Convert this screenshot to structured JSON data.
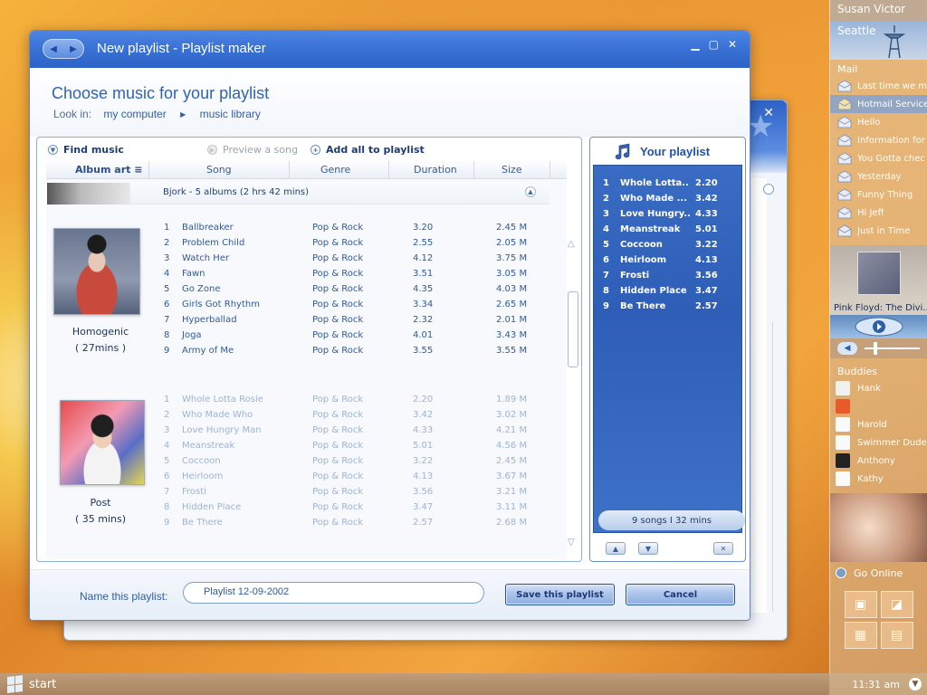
{
  "dialog": {
    "title": "New playlist - Playlist maker",
    "heading": "Choose music for your playlist",
    "look_in_label": "Look in:",
    "breadcrumb": [
      "my computer",
      "music library"
    ]
  },
  "toolbar": {
    "find_music": "Find music",
    "preview": "Preview a song",
    "add_all": "Add all to playlist"
  },
  "columns": [
    "Album art",
    "Song",
    "Genre",
    "Duration",
    "Size"
  ],
  "group": {
    "summary": "Bjork - 5 albums  (2 hrs 42 mins)"
  },
  "albums": [
    {
      "name": "Homogenic",
      "length": "( 27mins )",
      "tracks": [
        {
          "n": "1",
          "title": "Ballbreaker",
          "genre": "Pop & Rock",
          "duration": "3.20",
          "size": "2.45 M"
        },
        {
          "n": "2",
          "title": "Problem Child",
          "genre": "Pop & Rock",
          "duration": "2.55",
          "size": "2.05 M"
        },
        {
          "n": "3",
          "title": "Watch Her",
          "genre": "Pop & Rock",
          "duration": "4.12",
          "size": "3.75 M"
        },
        {
          "n": "4",
          "title": "Fawn",
          "genre": "Pop & Rock",
          "duration": "3.51",
          "size": "3.05 M"
        },
        {
          "n": "5",
          "title": "Go Zone",
          "genre": "Pop & Rock",
          "duration": "4.35",
          "size": "4.03 M"
        },
        {
          "n": "6",
          "title": "Girls Got Rhythm",
          "genre": "Pop & Rock",
          "duration": "3.34",
          "size": "2.65 M"
        },
        {
          "n": "7",
          "title": "Hyperballad",
          "genre": "Pop & Rock",
          "duration": "2.32",
          "size": "2.01 M"
        },
        {
          "n": "8",
          "title": "Joga",
          "genre": "Pop & Rock",
          "duration": "4.01",
          "size": "3.43 M"
        },
        {
          "n": "9",
          "title": "Army of Me",
          "genre": "Pop & Rock",
          "duration": "3.55",
          "size": "3.55 M"
        }
      ]
    },
    {
      "name": "Post",
      "length": "( 35 mins)",
      "tracks": [
        {
          "n": "1",
          "title": "Whole Lotta Rosie",
          "genre": "Pop & Rock",
          "duration": "2.20",
          "size": "1.89 M"
        },
        {
          "n": "2",
          "title": "Who Made Who",
          "genre": "Pop & Rock",
          "duration": "3.42",
          "size": "3.02 M"
        },
        {
          "n": "3",
          "title": "Love Hungry Man",
          "genre": "Pop & Rock",
          "duration": "4.33",
          "size": "4.21 M"
        },
        {
          "n": "4",
          "title": "Meanstreak",
          "genre": "Pop & Rock",
          "duration": "5.01",
          "size": "4.56 M"
        },
        {
          "n": "5",
          "title": "Coccoon",
          "genre": "Pop & Rock",
          "duration": "3.22",
          "size": "2.45 M"
        },
        {
          "n": "6",
          "title": "Heirloom",
          "genre": "Pop & Rock",
          "duration": "4.13",
          "size": "3.67 M"
        },
        {
          "n": "7",
          "title": "Frosti",
          "genre": "Pop & Rock",
          "duration": "3.56",
          "size": "3.21 M"
        },
        {
          "n": "8",
          "title": "Hidden Place",
          "genre": "Pop & Rock",
          "duration": "3.47",
          "size": "3.11 M"
        },
        {
          "n": "9",
          "title": "Be There",
          "genre": "Pop & Rock",
          "duration": "2.57",
          "size": "2.68 M"
        }
      ]
    }
  ],
  "playlist": {
    "title": "Your playlist",
    "items": [
      {
        "n": "1",
        "title": "Whole Lotta..",
        "duration": "2.20"
      },
      {
        "n": "2",
        "title": "Who Made ...",
        "duration": "3.42"
      },
      {
        "n": "3",
        "title": "Love Hungry..",
        "duration": "4.33"
      },
      {
        "n": "4",
        "title": "Meanstreak",
        "duration": "5.01"
      },
      {
        "n": "5",
        "title": "Coccoon",
        "duration": "3.22"
      },
      {
        "n": "6",
        "title": "Heirloom",
        "duration": "4.13"
      },
      {
        "n": "7",
        "title": "Frosti",
        "duration": "3.56"
      },
      {
        "n": "8",
        "title": "Hidden Place",
        "duration": "3.47"
      },
      {
        "n": "9",
        "title": "Be There",
        "duration": "2.57"
      }
    ],
    "summary": "9  songs   I   32 mins"
  },
  "footer": {
    "name_label": "Name this playlist:",
    "name_value": "Playlist 12-09-2002",
    "save": "Save this playlist",
    "cancel": "Cancel"
  },
  "sidebar": {
    "user": "Susan Victor",
    "city": "Seattle",
    "mail_label": "Mail",
    "mail": [
      "Last time we m",
      "Hotmail Service",
      "Hello",
      "Information for",
      "You Gotta chec",
      "Yesterday",
      "Funny Thing",
      "Hi Jeff",
      "Just in Time"
    ],
    "now_playing": "Pink Floyd: The Divi...",
    "buddies_label": "Buddies",
    "buddies": [
      "Hank",
      "",
      "Harold",
      "Swimmer Dude",
      "Anthony",
      "Kathy"
    ],
    "go_online": "Go Online"
  },
  "taskbar": {
    "start": "start",
    "clock": "11:31 am"
  },
  "colors": {
    "accent": "#2d63b8",
    "titlebar": "#3a72d6",
    "playlist_bg": "#2e5eb7"
  }
}
